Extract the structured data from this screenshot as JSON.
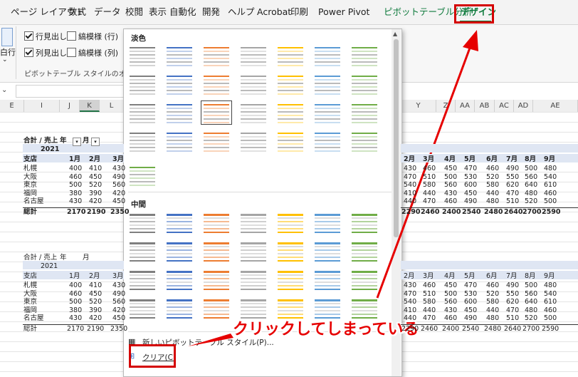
{
  "menu": {
    "items": [
      "ページ レイアウト",
      "数式",
      "データ",
      "校閲",
      "表示",
      "自動化",
      "開発",
      "ヘルプ",
      "Acrobat",
      "印刷",
      "Power Pivot",
      "ピボットテーブル分析",
      "デザイン"
    ],
    "active": "デザイン",
    "colors": {
      "active": "#0e7a3c"
    }
  },
  "ribbon": {
    "row_headers": "行見出し",
    "banded_rows": "縞模様 (行)",
    "col_headers": "列見出し",
    "banded_cols": "縞模様 (列)",
    "group_label": "ピボットテーブル スタイルのオプション",
    "left_stub": "白行"
  },
  "columns": [
    "E",
    "I",
    "J",
    "K",
    "L",
    "Y",
    "Z",
    "AA",
    "AB",
    "AC",
    "AD",
    "AE"
  ],
  "pivot1": {
    "title": "合計 / 売上",
    "year_label": "年",
    "month_label": "月",
    "year": "2021",
    "branch_label": "支店",
    "months_left": [
      "1月",
      "2月",
      "3月"
    ],
    "months_right": [
      "2月",
      "3月",
      "4月",
      "5月",
      "6月",
      "7月",
      "8月",
      "9月"
    ],
    "rows": [
      {
        "name": "札幌",
        "l": [
          "400",
          "410",
          "430"
        ],
        "r": [
          "430",
          "460",
          "450",
          "470",
          "460",
          "490",
          "500",
          "480"
        ]
      },
      {
        "name": "大阪",
        "l": [
          "460",
          "450",
          "490"
        ],
        "r": [
          "470",
          "510",
          "500",
          "530",
          "520",
          "550",
          "560",
          "540"
        ]
      },
      {
        "name": "東京",
        "l": [
          "500",
          "520",
          "560"
        ],
        "r": [
          "540",
          "580",
          "560",
          "600",
          "580",
          "620",
          "640",
          "610"
        ]
      },
      {
        "name": "福岡",
        "l": [
          "380",
          "390",
          "420"
        ],
        "r": [
          "410",
          "440",
          "430",
          "450",
          "440",
          "470",
          "480",
          "460"
        ]
      },
      {
        "name": "名古屋",
        "l": [
          "430",
          "420",
          "450"
        ],
        "r": [
          "440",
          "470",
          "460",
          "490",
          "480",
          "510",
          "520",
          "500"
        ]
      }
    ],
    "total_label": "総計",
    "total_l": [
      "2170",
      "2190",
      "2350"
    ],
    "total_r": [
      "2290",
      "2460",
      "2400",
      "2540",
      "2480",
      "2640",
      "2700",
      "2590"
    ]
  },
  "pivot2": {
    "title": "合計 / 売上",
    "year_label": "年",
    "month_label": "月",
    "year": "2021",
    "branch_label": "支店",
    "total_label": "総計"
  },
  "gallery": {
    "section_light": "淡色",
    "section_medium": "中間",
    "new_style": "新しいピボットテーブル スタイル(P)...",
    "clear": "クリア(C)",
    "light_colors": [
      "#7f7f7f",
      "#4472c4",
      "#ed7d31",
      "#a5a5a5",
      "#ffc000",
      "#5b9bd5",
      "#70ad47"
    ],
    "medium_colors": [
      "#7f7f7f",
      "#4472c4",
      "#ed7d31",
      "#a5a5a5",
      "#ffc000",
      "#5b9bd5",
      "#70ad47"
    ]
  },
  "annotation": {
    "text": "クリックしてしまっている",
    "color": "#e60000"
  }
}
